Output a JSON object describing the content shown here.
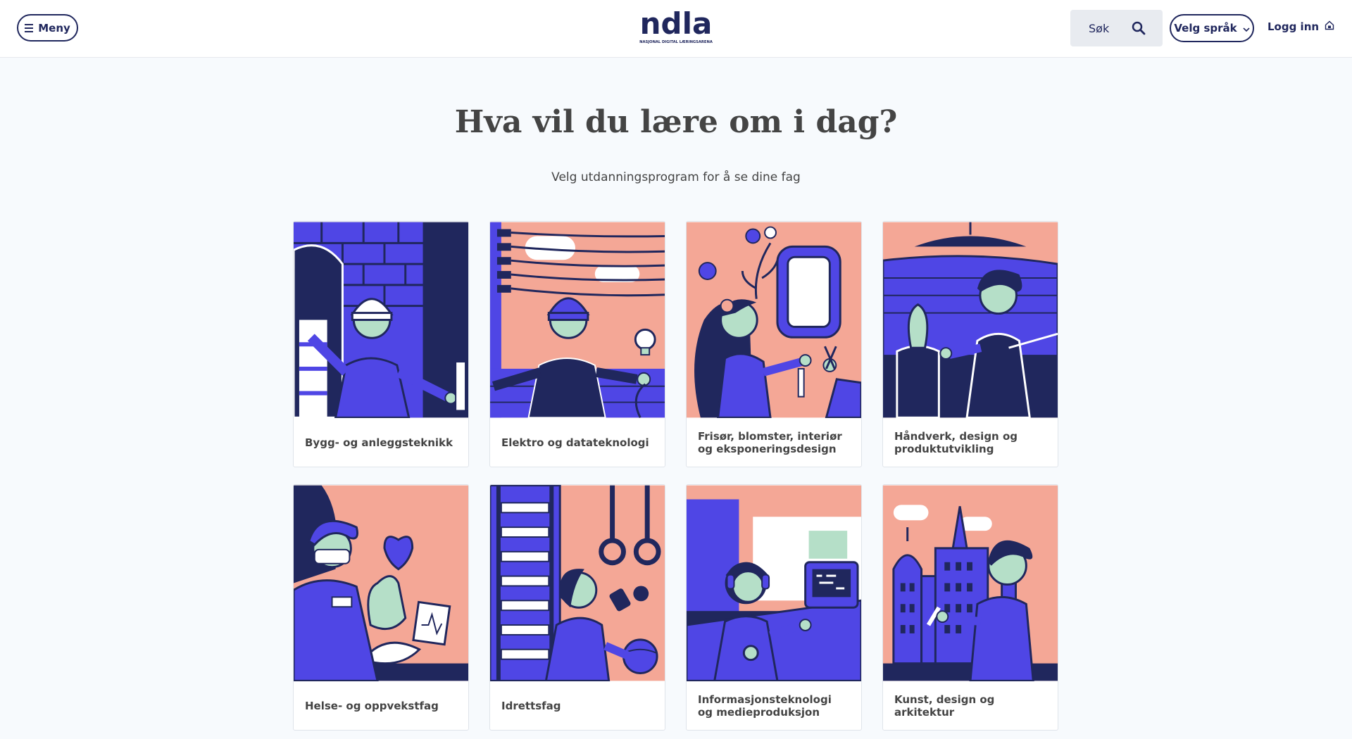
{
  "header": {
    "menu_label": "Meny",
    "logo_word": "ndla",
    "logo_tagline": "NASJONAL DIGITAL LÆRINGSARENA",
    "search_label": "Søk",
    "language_label": "Velg språk",
    "login_label": "Logg inn"
  },
  "main": {
    "title": "Hva vil du lære om i dag?",
    "subtitle": "Velg utdanningsprogram for å se dine fag"
  },
  "programs": [
    {
      "label": "Bygg- og anleggsteknikk"
    },
    {
      "label": "Elektro og datateknologi"
    },
    {
      "label": "Frisør, blomster, interiør og eksponeringsdesign"
    },
    {
      "label": "Håndverk, design og produktutvikling"
    },
    {
      "label": "Helse- og oppvekstfag"
    },
    {
      "label": "Idrettsfag"
    },
    {
      "label": "Informasjonsteknologi og medieproduksjon"
    },
    {
      "label": "Kunst, design og arkitektur"
    }
  ],
  "colors": {
    "brand_navy": "#20275d",
    "illustration_blue": "#4f46e5",
    "illustration_pink": "#f4a796",
    "illustration_mint": "#b5dfc8"
  },
  "icons": {
    "menu": "hamburger-icon",
    "search": "magnifier-icon",
    "language": "chevron-down-icon",
    "login": "house-lock-icon"
  }
}
